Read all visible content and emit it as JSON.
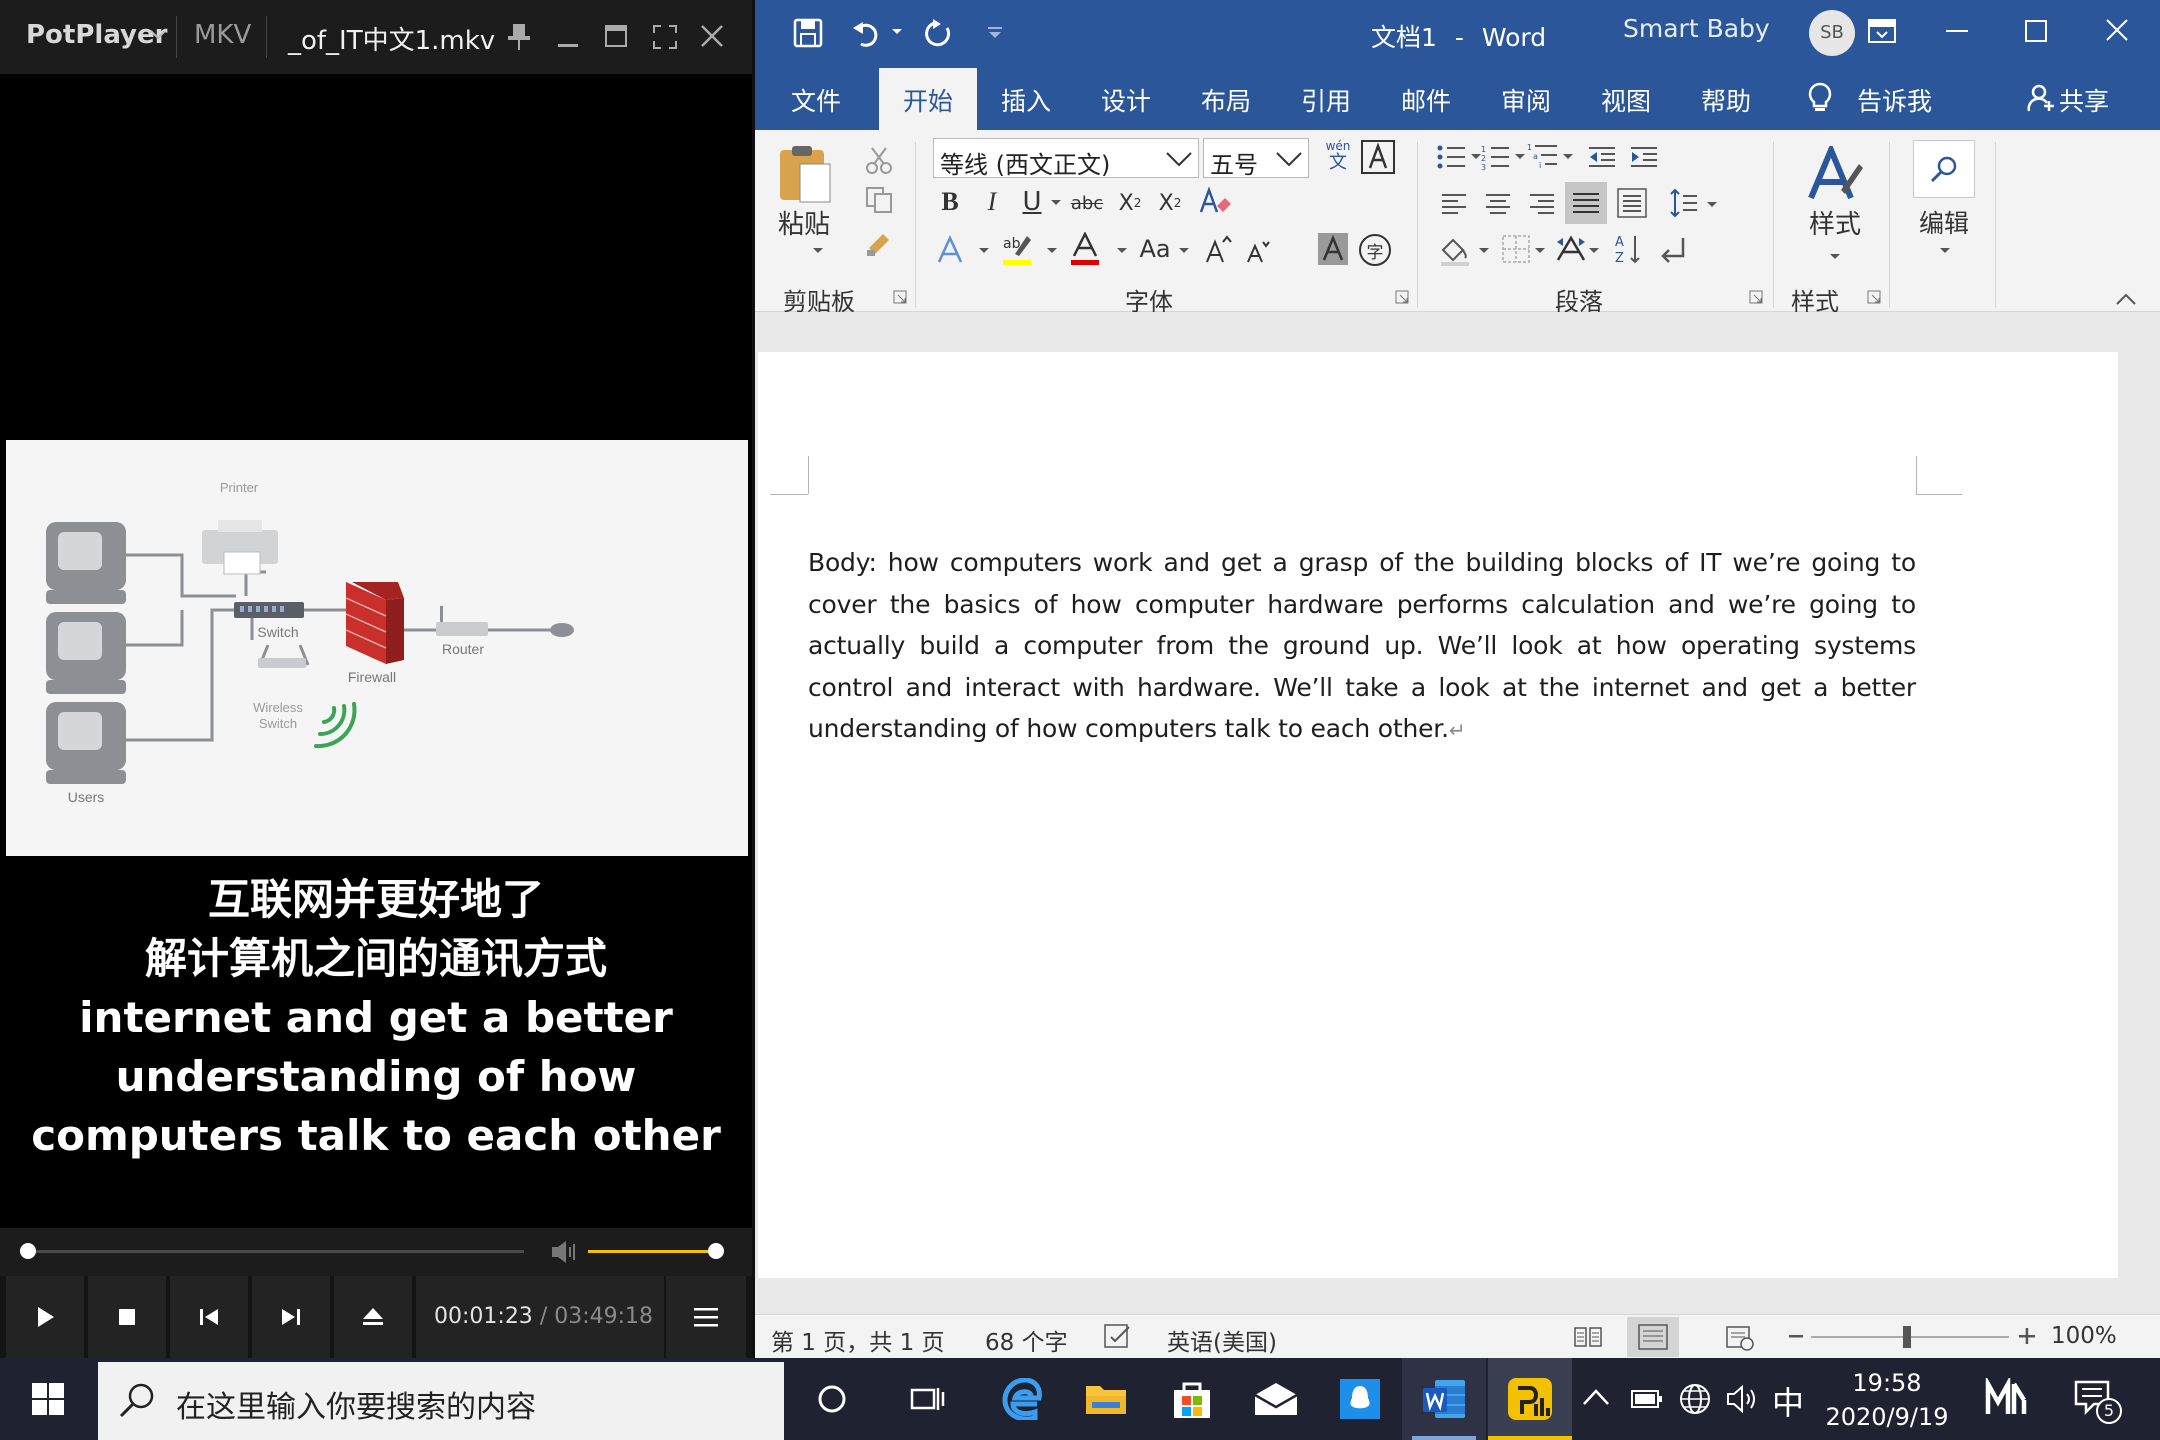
{
  "potplayer": {
    "app_name": "PotPlayer",
    "format": "MKV",
    "file_name": "_of_IT中文1.mkv",
    "diagram_labels": {
      "printer": "Printer",
      "switch": "Switch",
      "firewall": "Firewall",
      "router": "Router",
      "wireless_switch_line1": "Wireless",
      "wireless_switch_line2": "Switch",
      "users": "Users"
    },
    "subtitles": [
      "互联网并更好地了",
      "解计算机之间的通讯方式",
      "internet and get a better",
      "understanding of how",
      "computers talk to each other"
    ],
    "seek_progress": 0.0,
    "volume_level": 1.0,
    "time_current": "00:01:23",
    "time_separator": "/",
    "time_total": "03:49:18",
    "accent_color": "#f2c200"
  },
  "word": {
    "doc_title": "文档1",
    "title_sep": "-",
    "app_name": "Word",
    "user_name": "Smart Baby",
    "user_initials": "SB",
    "tabs": [
      "文件",
      "开始",
      "插入",
      "设计",
      "布局",
      "引用",
      "邮件",
      "审阅",
      "视图",
      "帮助"
    ],
    "tell_me": "告诉我",
    "share": "共享",
    "ribbon": {
      "paste": "粘贴",
      "clipboard_group": "剪贴板",
      "font_name": "等线 (西文正文)",
      "font_size": "五号",
      "phonetic_top": "wén",
      "phonetic_bottom": "文",
      "font_group": "字体",
      "paragraph_group": "段落",
      "styles_button": "样式",
      "styles_group": "样式",
      "editing_button": "编辑",
      "aa_label": "Aa",
      "enclose_char": "字"
    },
    "body_text": "Body: how computers work and get a grasp of the building blocks of IT we’re going to cover the basics of how computer hardware performs calculation and we’re going to actually build a computer from the ground up. We’ll look at how operating systems control and interact with hardware. We’ll take a look at the internet and get a better understanding of how computers talk to each other.",
    "paragraph_mark": "↵",
    "status": {
      "page": "第 1 页，共 1 页",
      "word_count": "68 个字",
      "language": "英语(美国)",
      "zoom": "100%"
    },
    "zoom_level": 1.0,
    "brand_color": "#2b579a"
  },
  "taskbar": {
    "search_placeholder": "在这里输入你要搜索的内容",
    "ime": "中",
    "time": "19:58",
    "date": "2020/9/19",
    "notification_count": "5"
  }
}
